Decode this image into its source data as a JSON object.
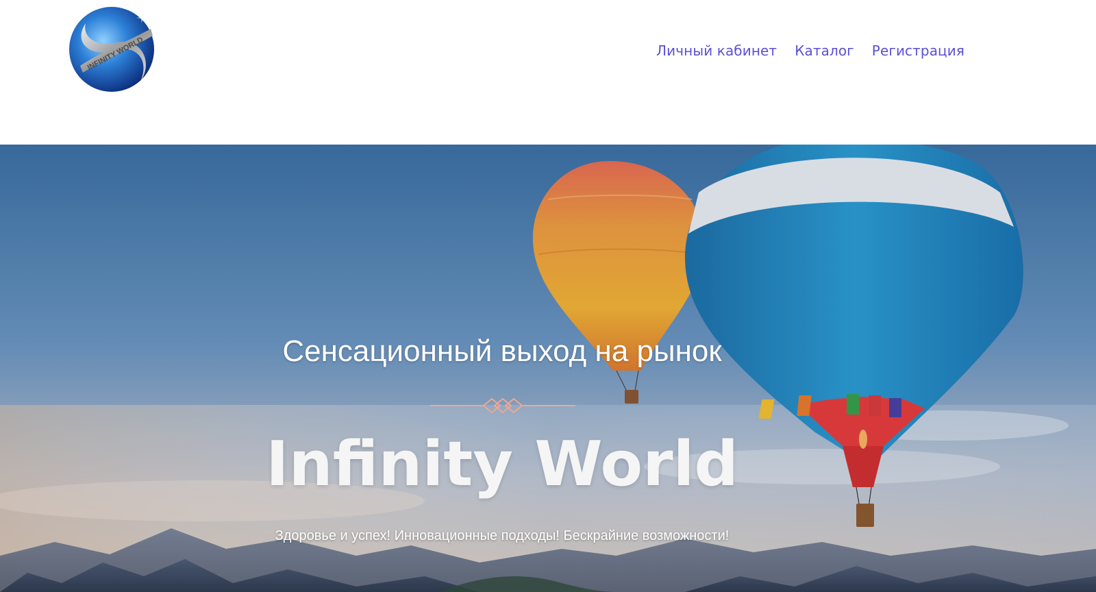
{
  "header": {
    "logo_text": "INFINITY WORLD",
    "nav": [
      {
        "label": "Личный кабинет"
      },
      {
        "label": "Каталог"
      },
      {
        "label": "Регистрация"
      }
    ]
  },
  "hero": {
    "subtitle": "Сенсационный выход на рынок",
    "title": "Infinity World",
    "tagline": "Здоровье и успех! Инновационные подходы! Бескрайние возможности!"
  },
  "colors": {
    "nav_link": "#5a50d6",
    "divider_accent": "#f0a792",
    "sky_top": "#3f74a8",
    "sky_bottom": "#d8c3ad"
  },
  "icons": {
    "logo": "infinity-world-globe-logo",
    "divider": "ornament-knot-divider"
  }
}
